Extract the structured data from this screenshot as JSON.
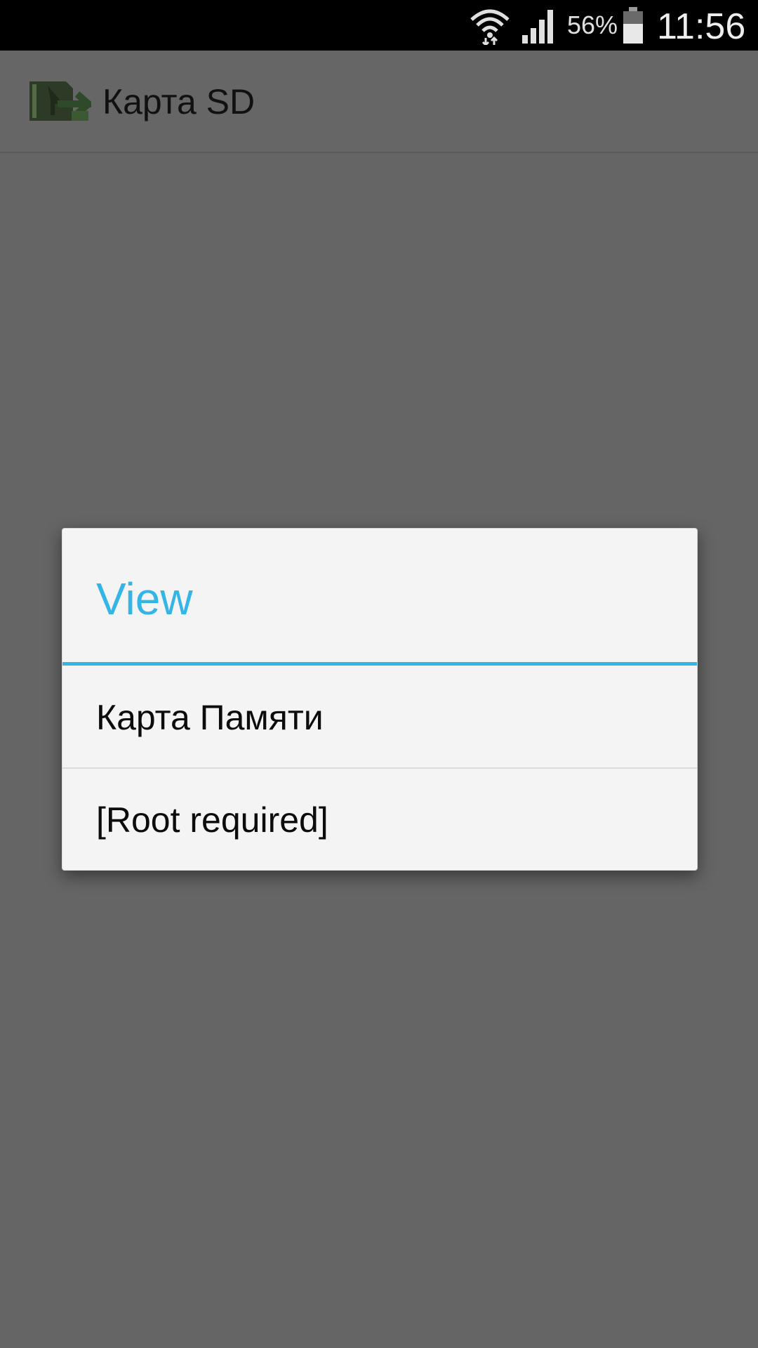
{
  "status_bar": {
    "battery_percent": "56%",
    "time": "11:56",
    "wifi_icon": "wifi-icon",
    "signal_icon": "cell-signal-icon",
    "battery_icon": "battery-icon"
  },
  "action_bar": {
    "app_icon": "sd-card-icon",
    "title": "Карта SD"
  },
  "dialog": {
    "title": "View",
    "accent_color": "#33b5e5",
    "items": [
      {
        "label": "Карта Памяти"
      },
      {
        "label": "[Root required]"
      }
    ]
  }
}
